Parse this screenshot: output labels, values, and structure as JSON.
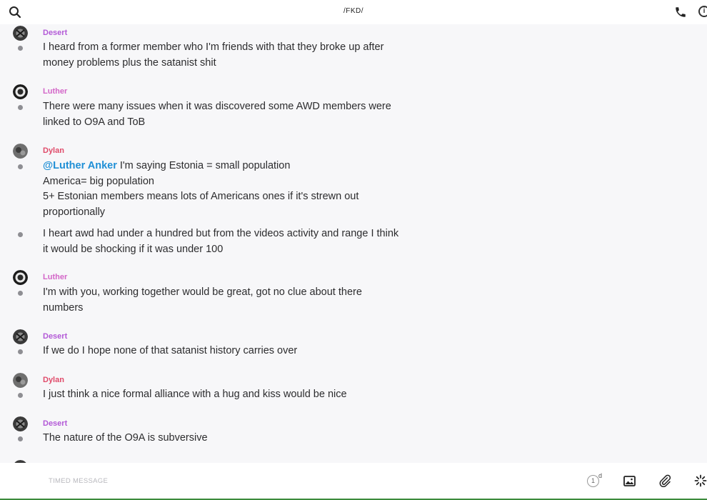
{
  "header": {
    "title": "/FKD/"
  },
  "messages": [
    {
      "sender": "Desert",
      "lines": [
        "I heard from a former member who I'm friends with that they broke up after",
        "money problems plus the satanist shit"
      ]
    },
    {
      "sender": "Luther",
      "lines": [
        "There were many issues when it was discovered some AWD members were",
        "linked to O9A and ToB"
      ]
    },
    {
      "sender": "Dylan",
      "mention": "@Luther Anker",
      "line1_rest": " I'm saying Estonia = small population",
      "lines": [
        "America= big population",
        "5+ Estonian members means lots of Americans ones if it's strewn out",
        "proportionally"
      ]
    },
    {
      "sender": null,
      "lines": [
        "I heart awd had under a hundred but from the videos activity and range I think",
        "it would be shocking if it was under 100"
      ]
    },
    {
      "sender": "Luther",
      "lines": [
        "I'm with you, working together would be great, got no clue about there",
        "numbers"
      ]
    },
    {
      "sender": "Desert",
      "lines": [
        "If we do I hope none of that satanist history carries over"
      ]
    },
    {
      "sender": "Dylan",
      "lines": [
        "I just think a nice formal alliance with a hug and kiss would be nice"
      ]
    },
    {
      "sender": "Desert",
      "lines": [
        "The nature of the O9A is subversive"
      ]
    }
  ],
  "composer": {
    "placeholder": "TIMED MESSAGE",
    "timer_value": "1",
    "timer_unit": "d"
  },
  "icons": [
    "search-icon",
    "phone-icon",
    "info-icon",
    "timer-icon",
    "image-icon",
    "paperclip-icon",
    "loading-spinner-icon"
  ],
  "colors": {
    "desert": "#b35ad7",
    "luther": "#d366c8",
    "dylan": "#e04b6a",
    "mention": "#1f8fd6"
  }
}
